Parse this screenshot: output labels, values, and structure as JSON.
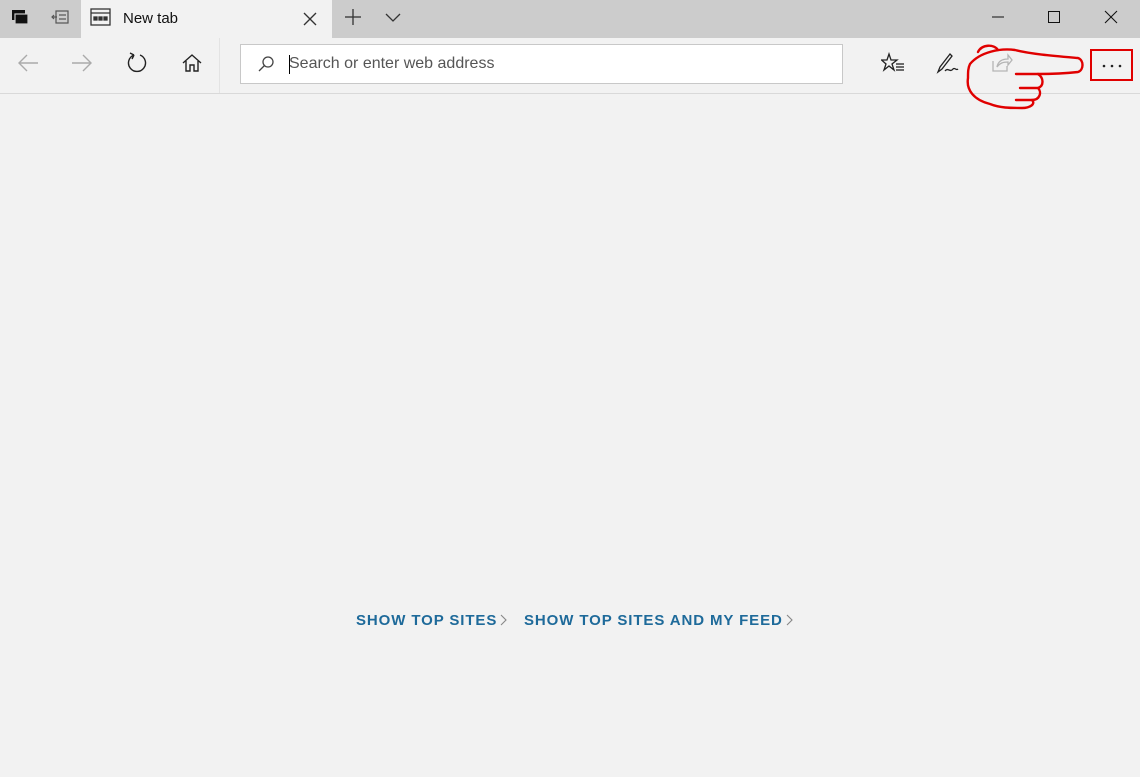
{
  "window": {
    "tab_title": "New tab",
    "icons": {
      "tab_manager": "tabs-icon",
      "set_aside": "set-aside-tabs-icon",
      "new_tab": "plus-icon",
      "tab_preview": "chevron-down-icon",
      "minimize": "minimize-icon",
      "maximize": "maximize-icon",
      "close": "close-icon"
    }
  },
  "toolbar": {
    "address_placeholder": "Search or enter web address",
    "address_value": "",
    "icons": [
      "back-arrow-icon",
      "forward-arrow-icon",
      "refresh-icon",
      "home-icon",
      "search-icon",
      "favorites-icon",
      "pen-icon",
      "share-icon",
      "more-icon"
    ]
  },
  "content": {
    "show_top_sites": "SHOW TOP SITES",
    "show_top_sites_and_feed": "SHOW TOP SITES AND MY FEED"
  },
  "annotation": {
    "highlight_color": "#e00000"
  }
}
